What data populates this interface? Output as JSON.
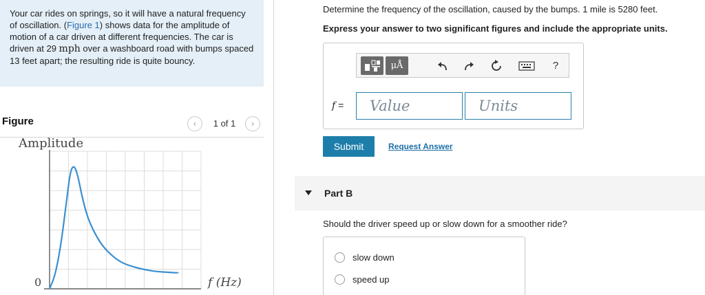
{
  "problem": {
    "text_part1": "Your car rides on springs, so it will have a natural frequency of oscillation. (",
    "figure_link": "Figure 1",
    "text_part2": ") shows data for the amplitude of motion of a car driven at different frequencies. The car is driven at 29 ",
    "unit": "mph",
    "text_part3": " over a washboard road with bumps spaced 13 feet apart; the resulting ride is quite bouncy."
  },
  "figure": {
    "label": "Figure",
    "pager": "1 of 1",
    "prev_icon": "chevron-left-icon",
    "next_icon": "chevron-right-icon"
  },
  "chart_data": {
    "type": "line",
    "ylabel": "Amplitude",
    "xlabel": "f (Hz)",
    "origin_label": "0",
    "axis_ticks": "none",
    "grid": true,
    "series": [
      {
        "x": [
          0.0,
          0.3,
          0.6,
          0.9,
          1.1,
          1.3,
          1.5,
          1.7,
          2.0,
          2.4,
          2.8,
          3.3,
          3.8,
          4.4,
          5.0,
          5.6,
          6.2,
          6.8
        ],
        "y": [
          0.0,
          0.5,
          1.6,
          3.2,
          4.3,
          4.5,
          4.1,
          3.4,
          2.6,
          2.0,
          1.55,
          1.2,
          0.95,
          0.8,
          0.7,
          0.63,
          0.6,
          0.58
        ]
      }
    ],
    "xlim": [
      0,
      8
    ],
    "ylim": [
      0,
      5
    ],
    "colors": {
      "line": "#3a8fd0",
      "grid": "#dcdcdc",
      "axis": "#444444"
    }
  },
  "partA": {
    "question": "Determine the frequency of the oscillation, caused by the bumps. 1 mile is 5280 feet.",
    "instruction": "Express your answer to two significant figures and include the appropriate units.",
    "toolbar": {
      "template_icon": "template-icon",
      "units_button": "μÅ",
      "undo_icon": "undo-icon",
      "redo_icon": "redo-icon",
      "reset_icon": "reset-icon",
      "keyboard_icon": "keyboard-icon",
      "help": "?"
    },
    "f_label": "f",
    "equals": "=",
    "value_placeholder": "Value",
    "units_placeholder": "Units",
    "submit": "Submit",
    "request_answer": "Request Answer"
  },
  "partB": {
    "title": "Part B",
    "question": "Should the driver speed up or slow down for a smoother ride?",
    "choices": [
      "slow down",
      "speed up"
    ]
  },
  "colors": {
    "accent": "#1e7eaa",
    "problem_bg": "#e4eff7",
    "link": "#2a6db0"
  }
}
